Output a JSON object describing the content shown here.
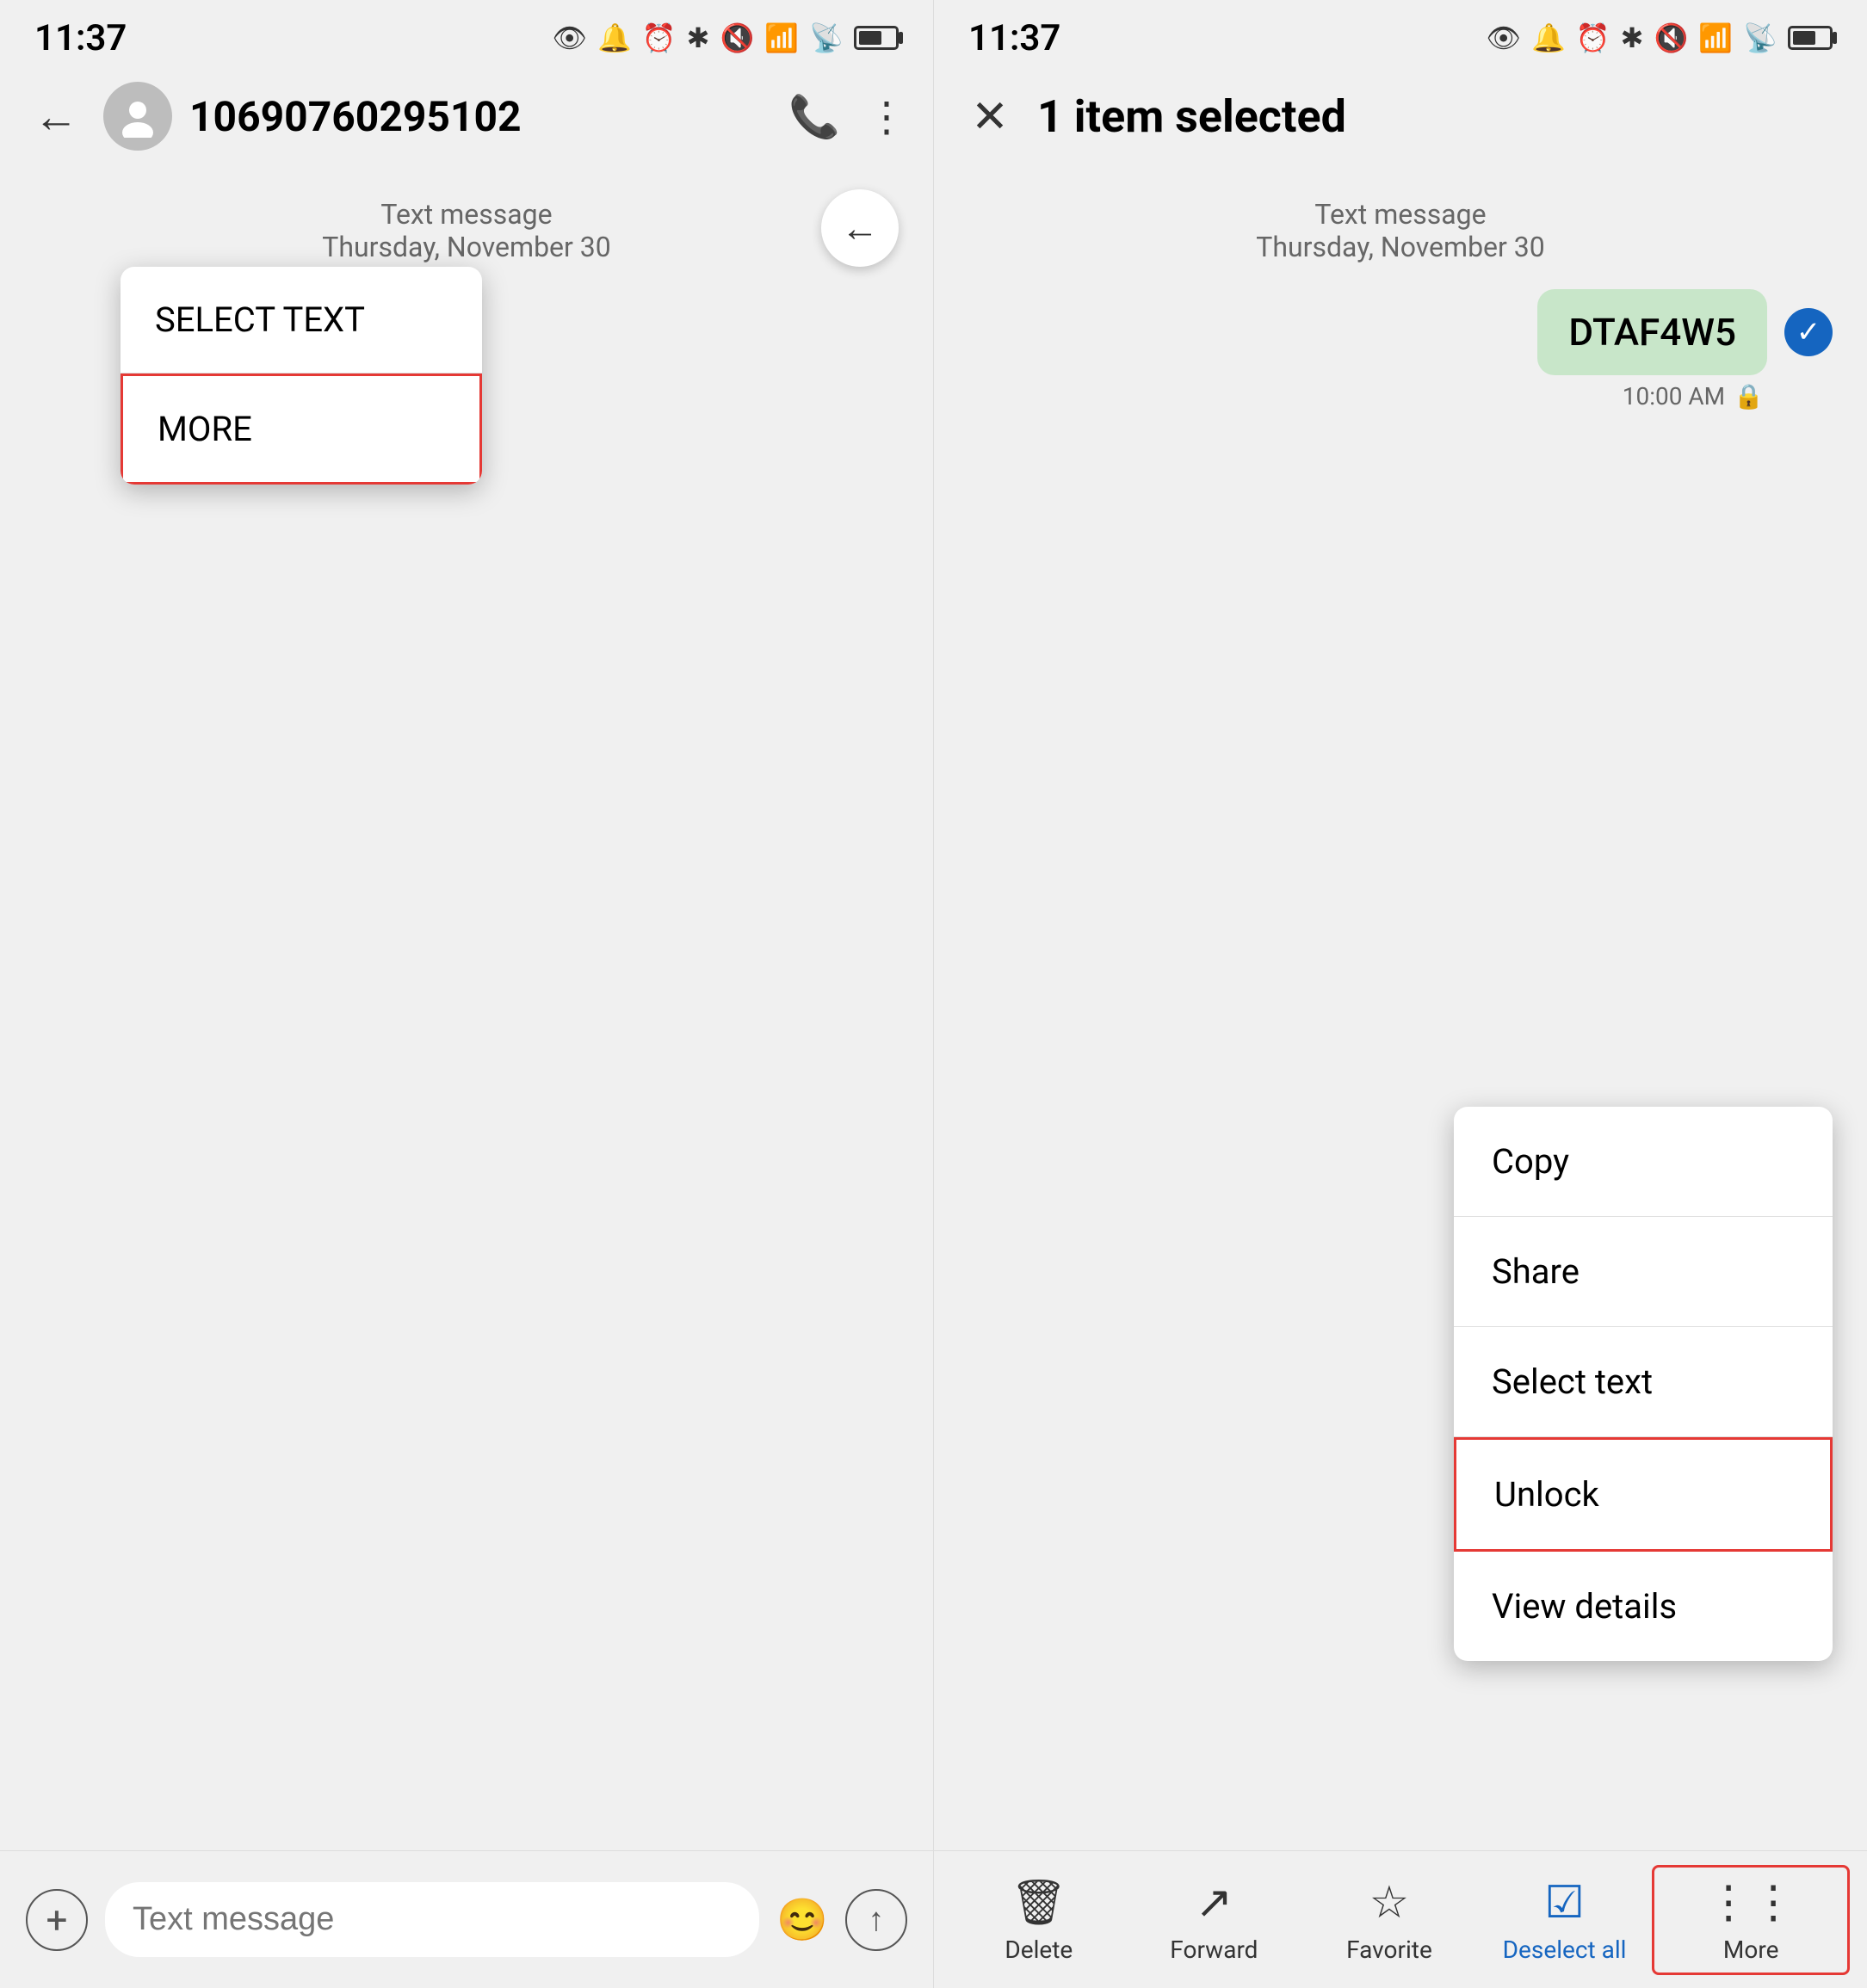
{
  "left": {
    "status_time": "11:37",
    "contact_name": "10690760295102",
    "header_back": "←",
    "message_date_label": "Text message",
    "message_date": "Thursday, November 30",
    "context_menu": {
      "select_text": "SELECT TEXT",
      "more": "MORE"
    },
    "bottom_bar": {
      "placeholder": "Text message"
    }
  },
  "right": {
    "status_time": "11:37",
    "selected_count": "1 item selected",
    "message_date_label": "Text message",
    "message_date": "Thursday, November 30",
    "bubble_text": "DTAF4W5",
    "message_time": "10:00 AM",
    "dropdown": {
      "copy": "Copy",
      "share": "Share",
      "select_text": "Select text",
      "unlock": "Unlock",
      "view_details": "View details"
    },
    "bottom_actions": {
      "delete": "Delete",
      "forward": "Forward",
      "favorite": "Favorite",
      "deselect_all": "Deselect all",
      "more": "More"
    }
  }
}
